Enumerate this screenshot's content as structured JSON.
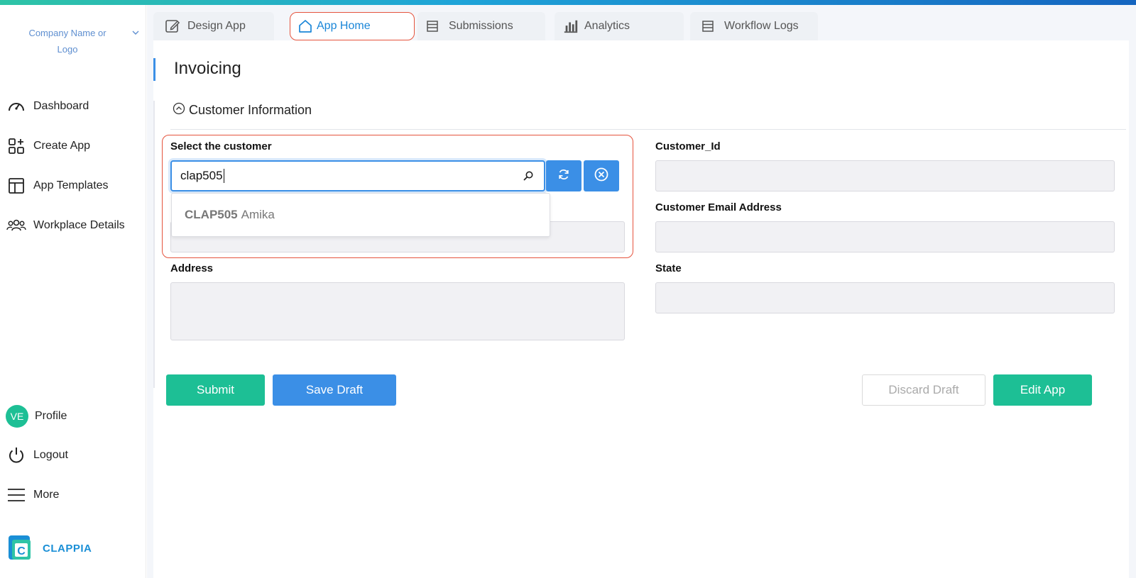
{
  "company": {
    "name": "Company Name or Logo"
  },
  "sidebar": {
    "items": [
      {
        "label": "Dashboard",
        "icon": "speedometer-icon"
      },
      {
        "label": "Create App",
        "icon": "add-apps-icon"
      },
      {
        "label": "App Templates",
        "icon": "template-icon"
      },
      {
        "label": "Workplace Details",
        "icon": "users-icon"
      }
    ],
    "profile": {
      "initials": "VE",
      "label": "Profile"
    },
    "logout_label": "Logout",
    "more_label": "More",
    "brand": "CLAPPIA",
    "brand_letter": "C"
  },
  "tabs": [
    {
      "label": "Design App",
      "icon": "edit-icon"
    },
    {
      "label": "App Home",
      "icon": "home-icon",
      "active": true
    },
    {
      "label": "Submissions",
      "icon": "list-icon"
    },
    {
      "label": "Analytics",
      "icon": "bar-chart-icon"
    },
    {
      "label": "Workflow Logs",
      "icon": "list-icon"
    }
  ],
  "page": {
    "title": "Invoicing",
    "section": "Customer Information"
  },
  "form": {
    "select_customer": {
      "label": "Select the customer",
      "value": "clap505",
      "suggestion_code": "CLAP505",
      "suggestion_name": "Amika"
    },
    "customer_id": {
      "label": "Customer_Id",
      "value": ""
    },
    "customer_email": {
      "label": "Customer Email Address",
      "value": ""
    },
    "address": {
      "label": "Address",
      "value": ""
    },
    "state": {
      "label": "State",
      "value": ""
    }
  },
  "buttons": {
    "submit": "Submit",
    "save_draft": "Save Draft",
    "discard_draft": "Discard Draft",
    "edit_app": "Edit App"
  },
  "colors": {
    "accent_blue": "#3b8fe6",
    "accent_green": "#1dbf95",
    "highlight_red": "#e5533d",
    "brand_blue": "#1a8fd6"
  }
}
